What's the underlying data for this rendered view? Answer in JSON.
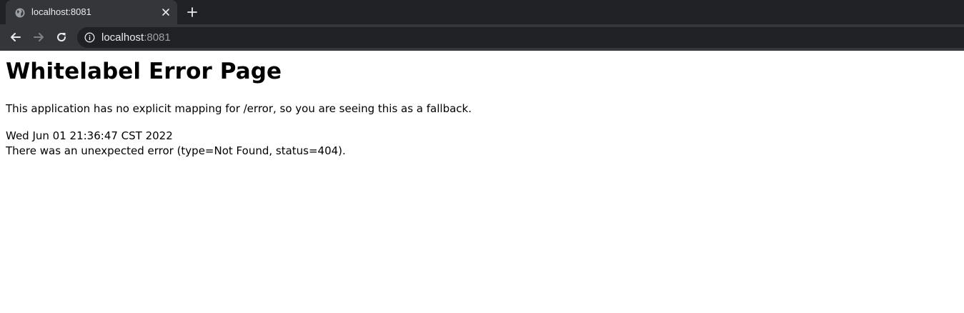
{
  "browser": {
    "tab": {
      "title": "localhost:8081",
      "favicon": "globe-icon",
      "close_icon": "close-icon"
    },
    "new_tab_icon": "plus-icon",
    "toolbar": {
      "back_icon": "arrow-left-icon",
      "forward_icon": "arrow-right-icon",
      "reload_icon": "reload-icon",
      "site_info_icon": "info-icon",
      "url_host": "localhost",
      "url_port": ":8081"
    },
    "colors": {
      "chrome_bg": "#202124",
      "active_tab_bg": "#35363a",
      "text_light": "#e8eaed",
      "text_muted": "#9aa0a6"
    }
  },
  "page": {
    "title": "Whitelabel Error Page",
    "description": "This application has no explicit mapping for /error, so you are seeing this as a fallback.",
    "timestamp": "Wed Jun 01 21:36:47 CST 2022",
    "error_message": "There was an unexpected error (type=Not Found, status=404)."
  }
}
